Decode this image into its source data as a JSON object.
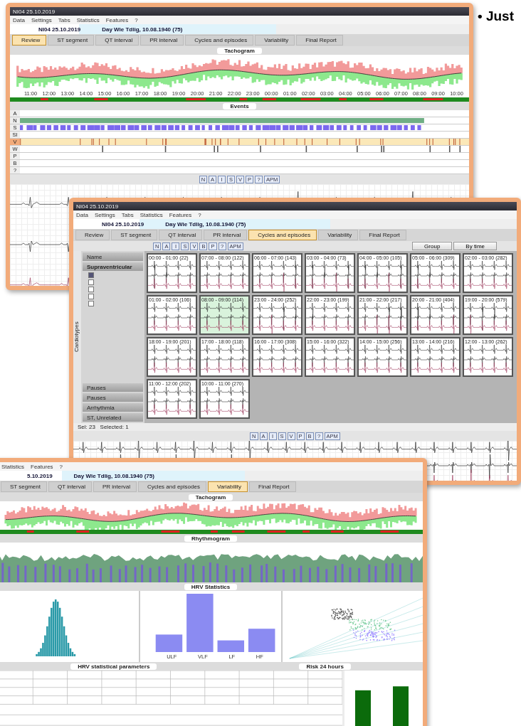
{
  "slide_text": "• Just",
  "review_window": {
    "title": "NI04 25.10.2019",
    "menu": [
      "Data",
      "Settings",
      "Tabs",
      "Statistics",
      "Features",
      "?"
    ],
    "patient": "NI04 25.10.2019",
    "subject": "Day Wie Tdlig, 10.08.1940 (75)",
    "tabs": [
      {
        "label": "Review",
        "selected": true
      },
      {
        "label": "ST segment",
        "selected": false
      },
      {
        "label": "QT interval",
        "selected": false
      },
      {
        "label": "PR interval",
        "selected": false
      },
      {
        "label": "Cycles and episodes",
        "selected": false
      },
      {
        "label": "Variability",
        "selected": false
      },
      {
        "label": "Final Report",
        "selected": false
      }
    ],
    "tachogram_title": "Tachogram",
    "times": [
      "11:00",
      "12:00",
      "13:00",
      "14:00",
      "15:00",
      "16:00",
      "17:00",
      "18:00",
      "19:00",
      "20:00",
      "21:00",
      "22:00",
      "23:00",
      "00:00",
      "01:00",
      "02:00",
      "03:00",
      "04:00",
      "05:00",
      "06:00",
      "07:00",
      "08:00",
      "09:00",
      "10:00"
    ],
    "events_title": "Events",
    "event_rows": [
      {
        "label": "A",
        "kind": "empty"
      },
      {
        "label": "N",
        "kind": "band",
        "color": "#6fae84"
      },
      {
        "label": "S",
        "kind": "blocks",
        "color": "#7b68ee"
      },
      {
        "label": "SI",
        "kind": "empty"
      },
      {
        "label": "V",
        "kind": "ticks",
        "color": "#fbe8b8"
      },
      {
        "label": "W",
        "kind": "sparse",
        "color": "#555555"
      },
      {
        "label": "P",
        "kind": "empty"
      },
      {
        "label": "B",
        "kind": "empty"
      },
      {
        "label": "?",
        "kind": "empty"
      }
    ],
    "tool_letters": [
      "N",
      "A",
      "I",
      "S",
      "V",
      "P",
      "?",
      "APM"
    ]
  },
  "cycles_window": {
    "title": "NI04 25.10.2019",
    "menu": [
      "Data",
      "Settings",
      "Tabs",
      "Statistics",
      "Features",
      "?"
    ],
    "patient": "NI04 25.10.2019",
    "subject": "Day Wie Tdlig, 10.08.1940 (75)",
    "tabs": [
      {
        "label": "Review",
        "selected": false
      },
      {
        "label": "ST segment",
        "selected": false
      },
      {
        "label": "QT interval",
        "selected": false
      },
      {
        "label": "PR interval",
        "selected": false
      },
      {
        "label": "Cycles and episodes",
        "selected": true
      },
      {
        "label": "Variability",
        "selected": false
      },
      {
        "label": "Final Report",
        "selected": false
      }
    ],
    "tool_letters": [
      "N",
      "A",
      "I",
      "S",
      "V",
      "B",
      "P",
      "?",
      "APM"
    ],
    "group": "Group",
    "sort": "By time",
    "name_header": "Name",
    "group_row": "Supraventricular",
    "side_label": "Cardiotypes",
    "checks": [
      {
        "checked": true
      },
      {
        "checked": false
      },
      {
        "checked": false
      },
      {
        "checked": false
      },
      {
        "checked": false
      }
    ],
    "sections": [
      "Pauses",
      "Pauses",
      "Arrhythmia",
      "ST, Unrelated"
    ],
    "tiles": [
      {
        "title": "00:00 - 01:00 (22)",
        "selected": false
      },
      {
        "title": "07:00 - 08:00 (122)",
        "selected": false
      },
      {
        "title": "06:00 - 07:00 (143)",
        "selected": false
      },
      {
        "title": "03:00 - 04:00 (73)",
        "selected": false
      },
      {
        "title": "04:00 - 05:00 (105)",
        "selected": false
      },
      {
        "title": "05:00 - 06:00 (309)",
        "selected": false
      },
      {
        "title": "02:00 - 03:00 (282)",
        "selected": false
      },
      {
        "title": "01:00 - 02:00 (106)",
        "selected": false
      },
      {
        "title": "08:00 - 09:00 (114)",
        "selected": true
      },
      {
        "title": "23:00 - 24:00 (252)",
        "selected": false
      },
      {
        "title": "22:00 - 23:00 (199)",
        "selected": false
      },
      {
        "title": "21:00 - 22:00 (217)",
        "selected": false
      },
      {
        "title": "20:00 - 21:00 (404)",
        "selected": false
      },
      {
        "title": "19:00 - 20:00 (579)",
        "selected": false
      },
      {
        "title": "18:00 - 19:00 (201)",
        "selected": false
      },
      {
        "title": "17:00 - 18:00 (118)",
        "selected": false
      },
      {
        "title": "16:00 - 17:00 (308)",
        "selected": false
      },
      {
        "title": "15:00 - 16:00 (322)",
        "selected": false
      },
      {
        "title": "14:00 - 15:00 (256)",
        "selected": false
      },
      {
        "title": "13:00 - 14:00 (216)",
        "selected": false
      },
      {
        "title": "12:00 - 13:00 (262)",
        "selected": false
      },
      {
        "title": "11:00 - 12:00 (202)",
        "selected": false
      },
      {
        "title": "10:00 - 11:00 (270)",
        "selected": false
      }
    ],
    "status": "Sel: 23   Selected: 1",
    "ecg_tool_letters": [
      "N",
      "A",
      "I",
      "S",
      "V",
      "P",
      "B",
      "?",
      "APM"
    ]
  },
  "variability_window": {
    "menu": [
      "Statistics",
      "Features",
      "?"
    ],
    "patient": "5.10.2019",
    "subject": "Day Wie Tdlig, 10.08.1940 (75)",
    "tabs": [
      {
        "label": "ST segment",
        "selected": false
      },
      {
        "label": "QT interval",
        "selected": false
      },
      {
        "label": "PR interval",
        "selected": false
      },
      {
        "label": "Cycles and episodes",
        "selected": false
      },
      {
        "label": "Variability",
        "selected": true
      },
      {
        "label": "Final Report",
        "selected": false
      }
    ],
    "tachogram_title": "Tachogram",
    "rhythm_title": "Rhythmogram",
    "stats_title": "HRV Statistics",
    "bands": [
      "ULF",
      "VLF",
      "LF",
      "HF"
    ],
    "params_title": "HRV statistical parameters",
    "risk_title": "Risk 24 hours"
  }
}
